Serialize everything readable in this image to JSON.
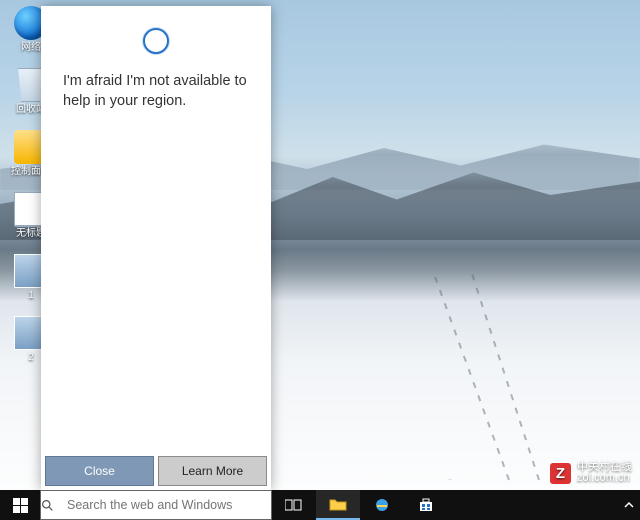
{
  "desktop_icons": [
    {
      "label": "网络",
      "kind": "globe"
    },
    {
      "label": "回收站",
      "kind": "bin"
    },
    {
      "label": "控制面板",
      "kind": "cpl"
    },
    {
      "label": "无标题",
      "kind": "file"
    },
    {
      "label": "1",
      "kind": "thumb"
    },
    {
      "label": "2",
      "kind": "thumb"
    }
  ],
  "cortana": {
    "message": "I'm afraid I'm not available to help in your region.",
    "close_label": "Close",
    "learn_label": "Learn More"
  },
  "taskbar": {
    "search_placeholder": "Search the web and Windows"
  },
  "watermark": {
    "logo": "Z",
    "line1": "中关村在线",
    "line2": "zol.com.cn"
  }
}
